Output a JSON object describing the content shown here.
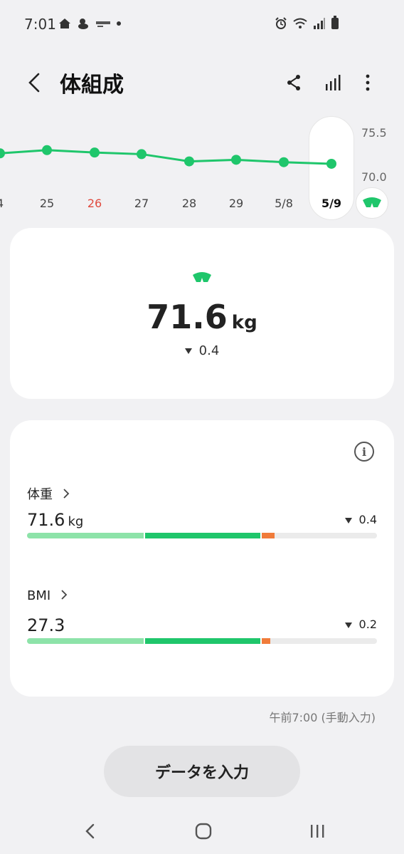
{
  "status_bar": {
    "time": "7:01",
    "left_icons": [
      "home-icon",
      "app-icon",
      "senior-app-icon",
      "dot-icon"
    ],
    "right_icons": [
      "alarm-icon",
      "wifi-icon",
      "signal-icon",
      "battery-icon"
    ]
  },
  "header": {
    "title": "体組成",
    "actions": [
      "share-icon",
      "chart-icon",
      "more-icon"
    ]
  },
  "chart_data": {
    "type": "line",
    "categories": [
      "4",
      "25",
      "26",
      "27",
      "28",
      "29",
      "5/8",
      "5/9"
    ],
    "values": [
      72.9,
      73.3,
      73.0,
      72.8,
      71.9,
      72.1,
      71.8,
      71.6
    ],
    "ytick_labels": [
      "75.5",
      "70.0"
    ],
    "ylim": [
      70.0,
      75.5
    ],
    "selected": "5/9",
    "highlight_label": "26",
    "colors": {
      "line": "#1fc66b",
      "highlight": "#e04b3f"
    }
  },
  "summary": {
    "value": "71.6",
    "unit": "kg",
    "delta": "0.4"
  },
  "metrics": [
    {
      "label": "体重",
      "value": "71.6",
      "unit": "kg",
      "delta": "0.4",
      "marker": 0.7
    },
    {
      "label": "BMI",
      "value": "27.3",
      "unit": "",
      "delta": "0.2",
      "marker": 0.68
    }
  ],
  "timestamp": "午前7:00 (手動入力)",
  "enter_button": "データを入力",
  "colors": {
    "accent": "#1fc66b",
    "light_green": "#8de3a9",
    "orange": "#f07b3a"
  }
}
